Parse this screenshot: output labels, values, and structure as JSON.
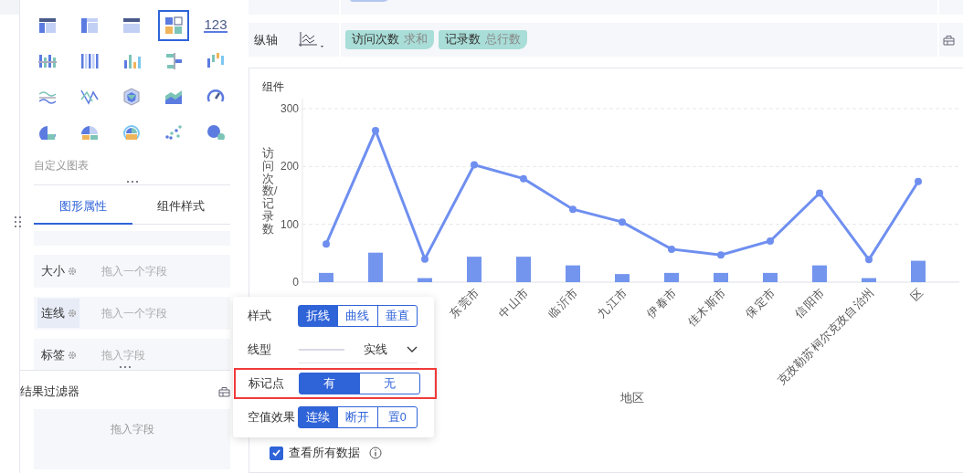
{
  "chart_types": [
    {
      "selected": false
    },
    {
      "selected": false
    },
    {
      "selected": false
    },
    {
      "selected": true
    },
    {
      "selected": false,
      "label": "123"
    },
    {
      "selected": false
    },
    {
      "selected": false
    },
    {
      "selected": false
    },
    {
      "selected": false
    },
    {
      "selected": false
    },
    {
      "selected": false
    },
    {
      "selected": false
    },
    {
      "selected": false
    },
    {
      "selected": false
    },
    {
      "selected": false
    },
    {
      "selected": false
    },
    {
      "selected": false
    },
    {
      "selected": false
    },
    {
      "selected": false
    },
    {
      "selected": false
    }
  ],
  "custom_chart_label": "自定义图表",
  "property_tabs": [
    {
      "label": "图形属性",
      "selected": true
    },
    {
      "label": "组件样式",
      "selected": false
    }
  ],
  "property_rows": [
    {
      "label": "大小",
      "hint": "拖入一个字段",
      "active": false
    },
    {
      "label": "连线",
      "hint": "拖入一个字段",
      "active": true
    },
    {
      "label": "标签",
      "hint": "拖入字段",
      "active": false
    }
  ],
  "result_filter": {
    "title": "结果过滤器",
    "hint": "拖入字段"
  },
  "y_axis_row": {
    "label": "纵轴",
    "chips": [
      {
        "name": "访问次数",
        "aggregate": "求和"
      },
      {
        "name": "记录数",
        "aggregate": "总行数"
      }
    ]
  },
  "chart_card": {
    "title": "组件",
    "chart_data": {
      "type": "bar",
      "xlabel": "地区",
      "ylabel": "访问次数/记录数",
      "categories": [
        null,
        null,
        null,
        "东莞市",
        "中山市",
        "临沂市",
        "九江市",
        "伊春市",
        "佳木斯市",
        "保定市",
        "信阳市",
        "克孜勒苏柯尔克孜自治州",
        "区"
      ],
      "series": [
        {
          "type": "line",
          "marker": true,
          "color": "#6f8ff0",
          "values": [
            66,
            262,
            40,
            203,
            179,
            126,
            104,
            57,
            47,
            71,
            154,
            39,
            174
          ]
        },
        {
          "color": "#7395ee",
          "values": [
            16,
            51,
            7,
            44,
            44,
            29,
            14,
            16,
            16,
            16,
            29,
            7,
            37
          ]
        }
      ],
      "ylim": [
        0,
        300
      ],
      "yticks": [
        0,
        100,
        200,
        300
      ]
    },
    "view_all": {
      "label": "查看所有数据",
      "checked": true
    }
  },
  "line_settings_popup": {
    "rows": [
      {
        "kind": "segmented",
        "label": "样式",
        "highlighted": false,
        "options": [
          {
            "label": "折线",
            "selected": true
          },
          {
            "label": "曲线",
            "selected": false
          },
          {
            "label": "垂直",
            "selected": false
          }
        ]
      },
      {
        "kind": "dropdown",
        "label": "线型",
        "highlighted": false,
        "value": "实线"
      },
      {
        "kind": "segmented",
        "label": "标记点",
        "highlighted": true,
        "options": [
          {
            "label": "有",
            "selected": true
          },
          {
            "label": "无",
            "selected": false
          }
        ]
      },
      {
        "kind": "segmented",
        "label": "空值效果",
        "highlighted": false,
        "options": [
          {
            "label": "连续",
            "selected": true
          },
          {
            "label": "断开",
            "selected": false
          },
          {
            "label": "置0",
            "selected": false
          }
        ]
      }
    ]
  }
}
